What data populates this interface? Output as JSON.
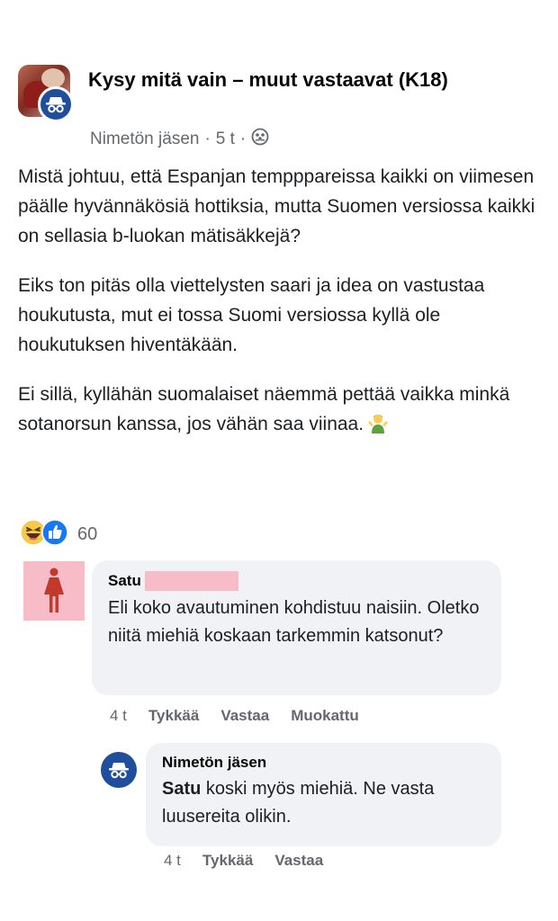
{
  "post": {
    "group_name": "Kysy mitä vain – muut vastaavat (K18)",
    "author": "Nimetön jäsen",
    "separator": "·",
    "time": "5 t",
    "privacy_icon": "group-icon",
    "paragraphs": [
      "Mistä johtuu, että Espanjan tempppareissa kaikki on viimesen päälle hyvännäkösiä hottiksia, mutta Suomen versiossa kaikki on sellasia b-luokan mätisäkkejä?",
      "Eiks ton pitäs olla viettelysten saari ja idea on vastustaa houkutusta, mut ei tossa Suomi versiossa kyllä ole houkutuksen hiventäkään.",
      "Ei sillä, kyllähän suomalaiset näemmä pettää vaikka minkä sotanorsun kanssa, jos vähän saa viinaa."
    ],
    "reactions": {
      "icons": [
        "haha-reaction-icon",
        "like-reaction-icon"
      ],
      "count": "60"
    }
  },
  "comments": [
    {
      "author": "Satu",
      "text": "Eli koko avautuminen kohdistuu naisiin. Oletko niitä miehiä koskaan tarkemmin katsonut?",
      "time": "4 t",
      "like": "Tykkää",
      "reply": "Vastaa",
      "edited": "Muokattu"
    },
    {
      "author": "Nimetön jäsen",
      "mention": "Satu",
      "text": " koski myös miehiä. Ne vasta luusereita olikin.",
      "time": "4 t",
      "like": "Tykkää",
      "reply": "Vastaa"
    }
  ],
  "colors": {
    "anon_badge": "#1f4f9c",
    "redaction_pink": "#f7bcc8",
    "bubble_bg": "#f0f2f5",
    "secondary_text": "#65676b"
  }
}
